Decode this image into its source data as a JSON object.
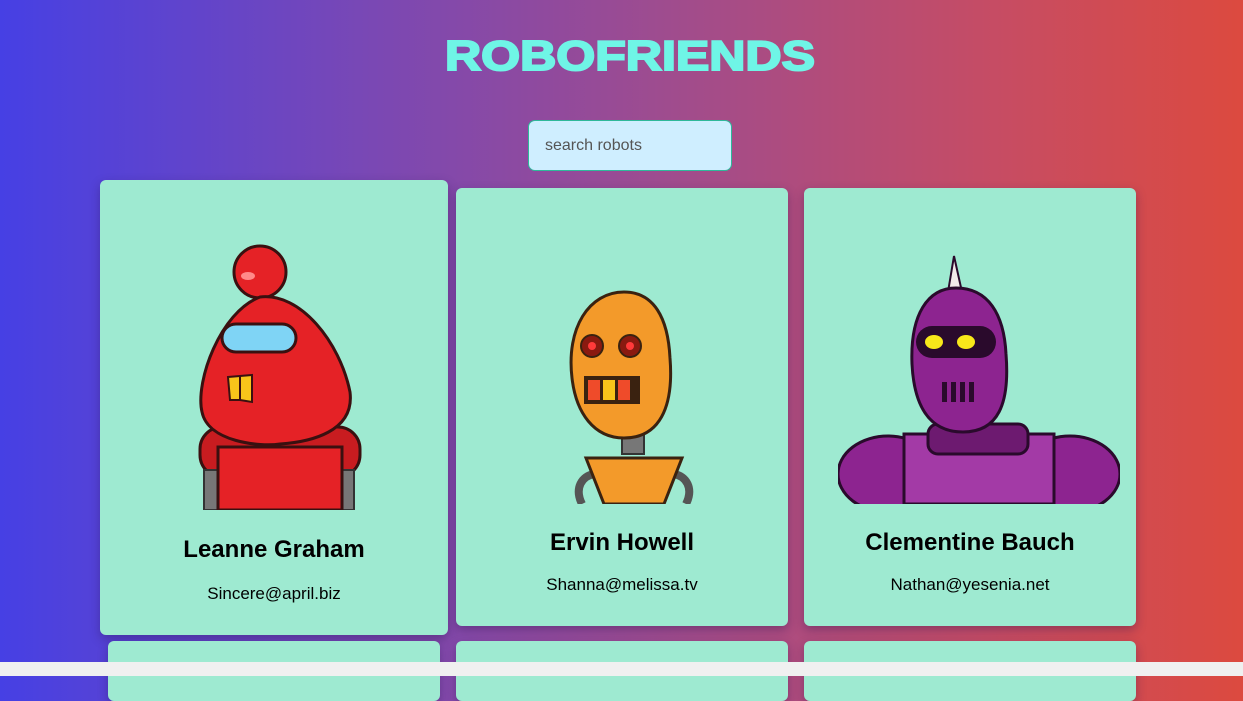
{
  "app": {
    "title": "ROBOFRIENDS"
  },
  "search": {
    "placeholder": "search robots",
    "value": ""
  },
  "robots": [
    {
      "name": "Leanne Graham",
      "email": "Sincere@april.biz",
      "color": "#e52226"
    },
    {
      "name": "Ervin Howell",
      "email": "Shanna@melissa.tv",
      "color": "#f39a2a"
    },
    {
      "name": "Clementine Bauch",
      "email": "Nathan@yesenia.net",
      "color": "#8d2490"
    }
  ],
  "colors": {
    "card": "#9eead1",
    "title": "#6ff5e6",
    "search_bg": "#cfeeff"
  }
}
